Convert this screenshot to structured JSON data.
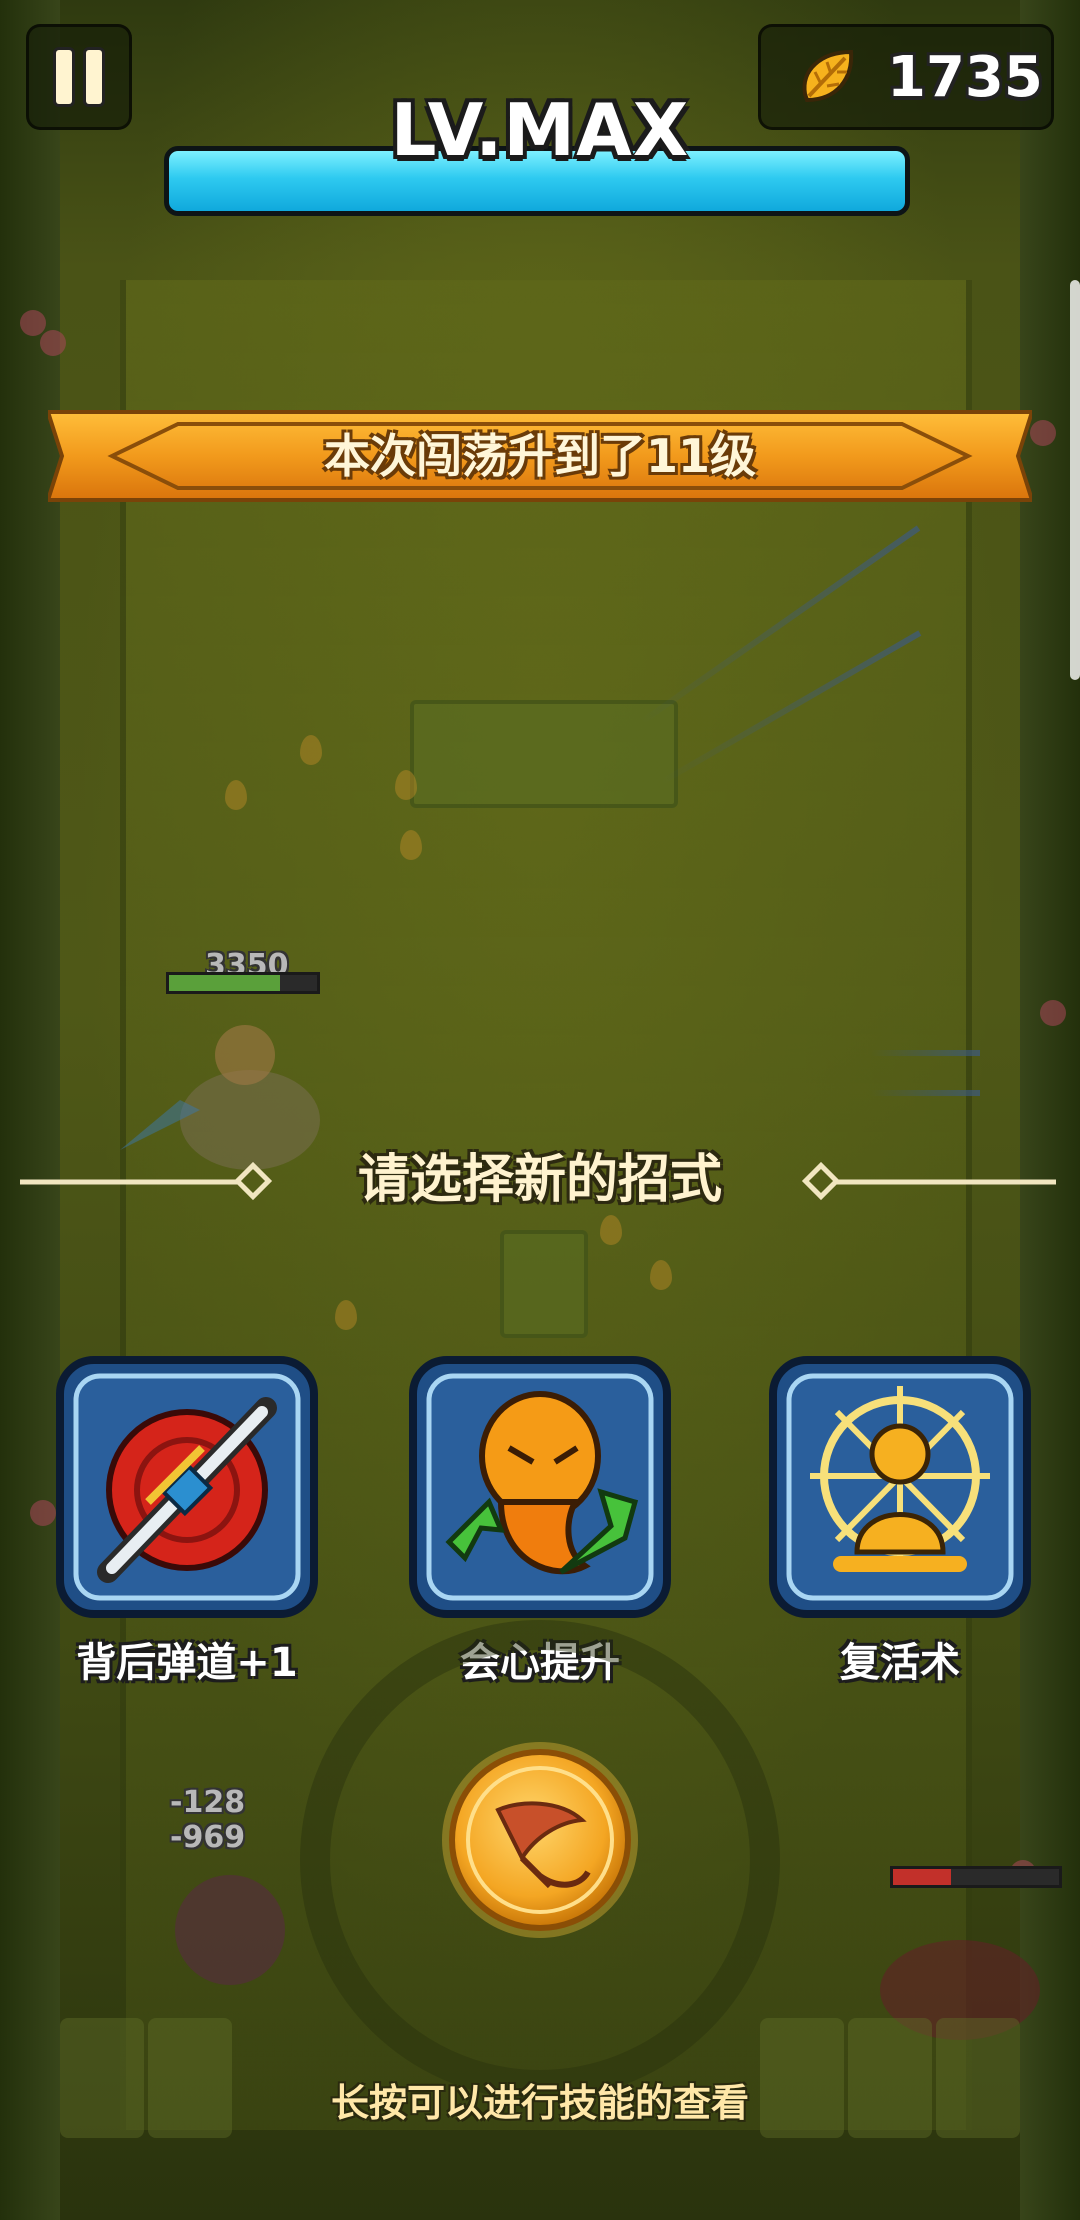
{
  "hud": {
    "coins": "1735",
    "level_label": "LV.MAX",
    "xp_progress": 1.0
  },
  "banner": {
    "text": "本次闯荡升到了11级"
  },
  "battle": {
    "enemy_hp_text": "3350",
    "floating_numbers": [
      "-128",
      "-969"
    ]
  },
  "selection": {
    "title": "请选择新的招式",
    "skills": [
      {
        "name": "背后弹道+1",
        "icon": "sword-target-icon"
      },
      {
        "name": "会心提升",
        "icon": "crit-boost-icon"
      },
      {
        "name": "复活术",
        "icon": "revive-monk-icon"
      }
    ],
    "hint": "长按可以进行技能的查看"
  },
  "colors": {
    "xp_bar": "#2ecaf0",
    "banner_orange": "#f29a1c",
    "card_blue": "#1f4e86",
    "attack_gold": "#f4a623"
  }
}
